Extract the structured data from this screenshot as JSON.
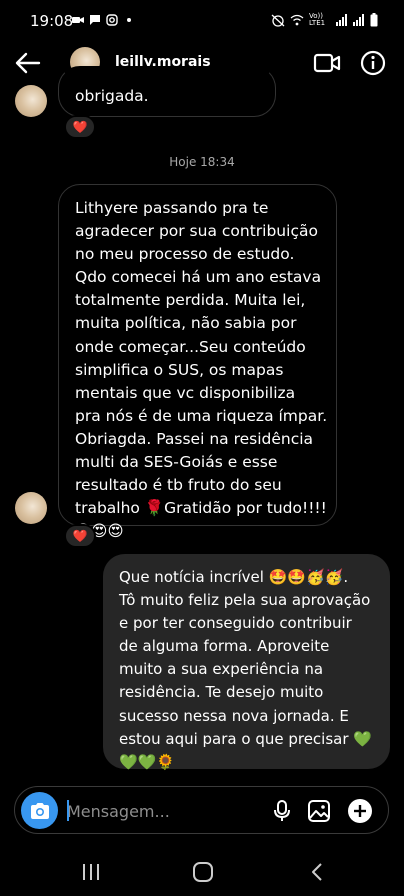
{
  "status_bar": {
    "time": "19:08",
    "left_icons": [
      "video-call-notification-icon",
      "chat-notification-icon",
      "instagram-notification-icon",
      "more-dot-icon"
    ],
    "network_label": "Vo)) LTE1",
    "right_icons": [
      "alarm-off-icon",
      "wifi-icon",
      "signal-icon",
      "signal-icon",
      "battery-icon"
    ]
  },
  "header": {
    "username": "leilly.morais",
    "icons": [
      "back-arrow-icon",
      "video-camera-icon",
      "info-icon"
    ]
  },
  "chat": {
    "earlier_message": {
      "text": "obrigada.",
      "reaction": "❤️"
    },
    "timestamp": "Hoje 18:34",
    "incoming_message": {
      "text": "Lithyere passando pra te\nagradecer por sua contribuição\nno meu processo de estudo.\nQdo comecei há um ano estava\ntotalmente perdida. Muita lei,\nmuita política, não sabia por\nonde começar...Seu conteúdo\nsimplifica o SUS, os mapas\nmentais que vc disponibiliza\npra nós é de uma riqueza ímpar.\nObriagda. Passei na residência\nmulti da SES-Goiás e esse\nresultado é tb fruto do seu\ntrabalho 🌹Gratidão por tudo!!!!\n😍😍😍",
      "reaction": "❤️"
    },
    "outgoing_message": {
      "text": "Que notícia incrível 🤩🤩🥳🥳.\nTô muito feliz pela sua aprovação\ne por ter conseguido contribuir\nde alguma forma. Aproveite\nmuito a sua experiência na\nresidência. Te desejo muito\nsucesso nessa nova jornada. E\nestou aqui para o que precisar 💚\n💚💚🌻"
    }
  },
  "composer": {
    "placeholder": "Mensagem...",
    "icons": [
      "camera-icon",
      "microphone-icon",
      "gallery-icon",
      "add-icon"
    ]
  },
  "nav_bar": {
    "icons": [
      "recent-apps-icon",
      "home-icon",
      "back-icon"
    ]
  },
  "colors": {
    "background": "#000000",
    "outgoing_bubble": "#262626",
    "incoming_border": "#333333",
    "accent_blue": "#3897f0",
    "heart_red": "#ed1c24",
    "muted_text": "#a8a8a8"
  }
}
